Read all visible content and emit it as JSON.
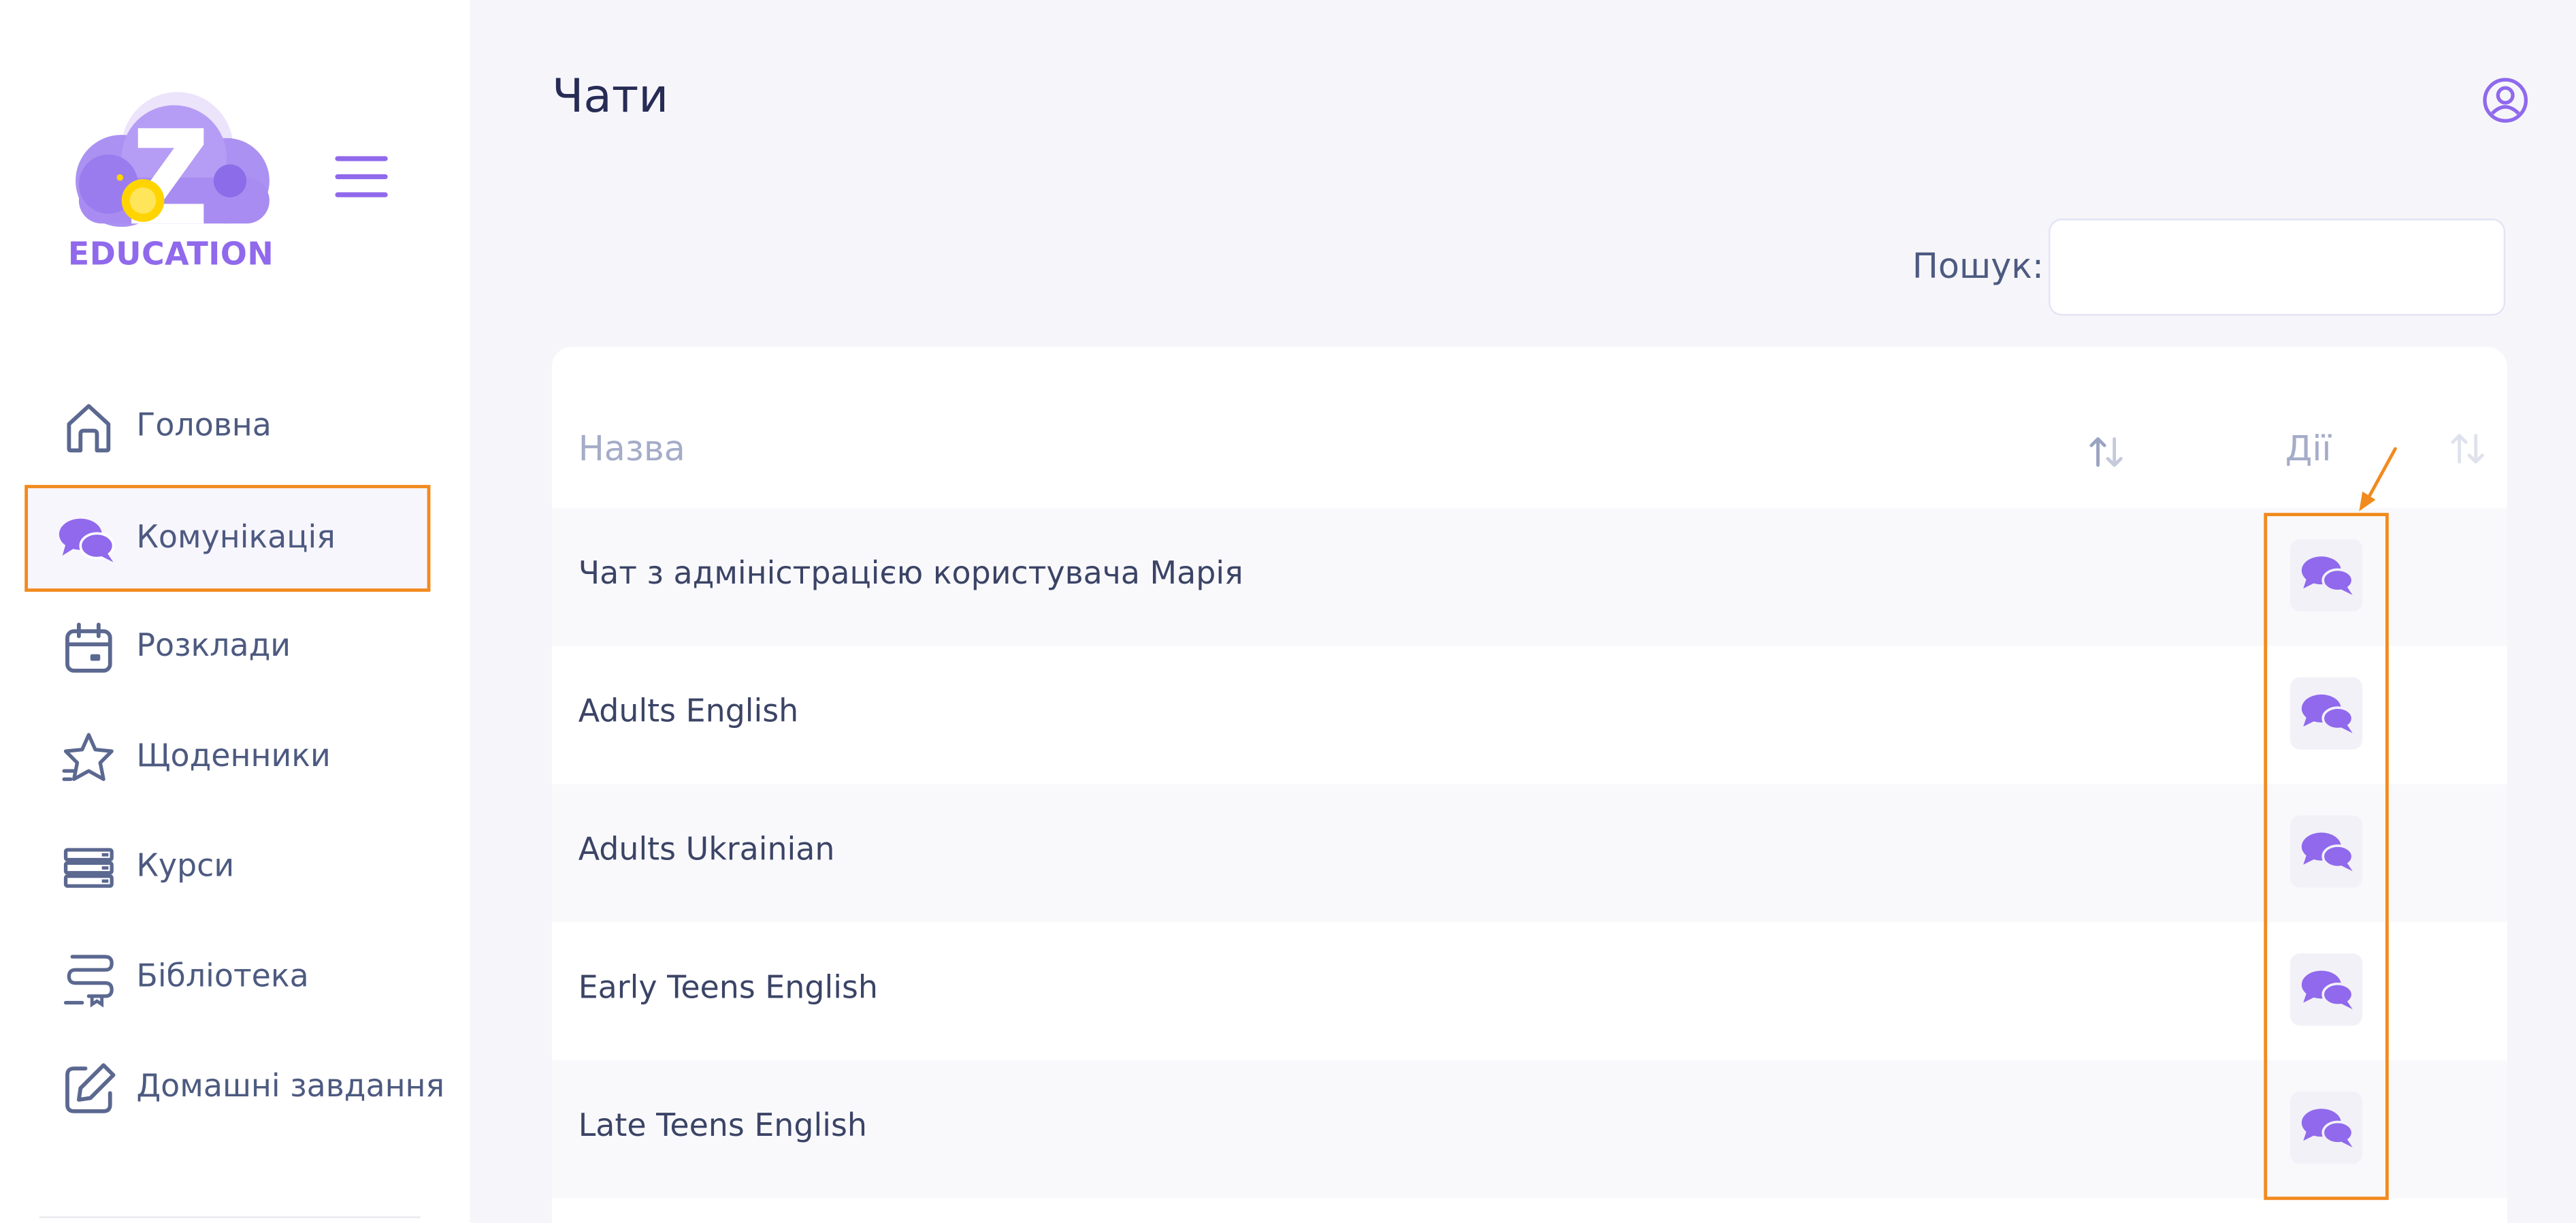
{
  "brand": {
    "logo_text": "EDUCATION",
    "accent_color": "#9069ec",
    "highlight_color": "#f28a1f"
  },
  "sidebar": {
    "items": [
      {
        "label": "Головна",
        "icon": "home-icon",
        "active": false
      },
      {
        "label": "Комунікація",
        "icon": "chat-icon",
        "active": true
      },
      {
        "label": "Розклади",
        "icon": "calendar-icon",
        "active": false
      },
      {
        "label": "Щоденники",
        "icon": "star-icon",
        "active": false
      },
      {
        "label": "Курси",
        "icon": "stack-icon",
        "active": false
      },
      {
        "label": "Бібліотека",
        "icon": "library-icon",
        "active": false
      },
      {
        "label": "Домашні завдання",
        "icon": "edit-icon",
        "active": false
      }
    ]
  },
  "header": {
    "title": "Чати"
  },
  "search": {
    "label": "Пошук:",
    "value": "",
    "placeholder": ""
  },
  "table": {
    "columns": [
      "Назва",
      "Дії"
    ],
    "rows": [
      {
        "name": "Чат з адміністрацією користувача Марія"
      },
      {
        "name": "Adults English"
      },
      {
        "name": "Adults Ukrainian"
      },
      {
        "name": "Early Teens English"
      },
      {
        "name": "Late Teens English"
      }
    ]
  }
}
